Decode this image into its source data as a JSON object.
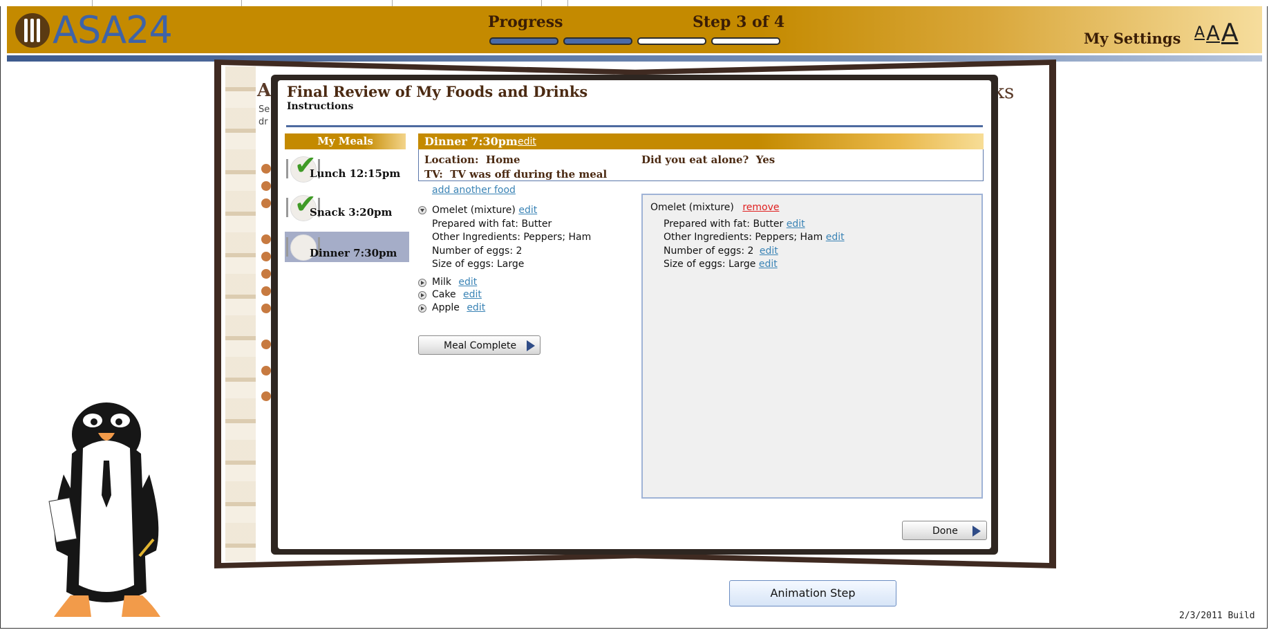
{
  "app": {
    "logo_text": "ASA24",
    "progress_label": "Progress",
    "step_label": "Step 3 of 4",
    "progress": {
      "completed_steps": 2,
      "total_steps": 4
    },
    "settings_label": "My Settings",
    "font_sizes": [
      "A",
      "A",
      "A"
    ]
  },
  "background": {
    "heading_left": "A",
    "sub_line1": "Se",
    "sub_line2": "dr",
    "heading_right": "ks"
  },
  "dialog": {
    "title": "Final Review of My Foods and Drinks",
    "instructions": "Instructions",
    "meals_header": "My Meals",
    "meals": [
      {
        "label": "Lunch 12:15pm",
        "checked": true
      },
      {
        "label": "Snack 3:20pm",
        "checked": true
      },
      {
        "label": "Dinner 7:30pm",
        "checked": false,
        "selected": true
      }
    ],
    "current_meal": {
      "title": "Dinner 7:30pm",
      "edit": "edit",
      "location": "Location:  Home",
      "ate_alone": "Did you eat alone?  Yes",
      "tv": "TV:  TV was off during the meal"
    },
    "add_food": "add another food",
    "foods": [
      {
        "name": "Omelet (mixture)",
        "edit": "edit",
        "expanded": true,
        "details": [
          "Prepared with fat: Butter",
          "Other Ingredients: Peppers; Ham",
          "Number of eggs: 2",
          "Size of eggs: Large"
        ]
      },
      {
        "name": "Milk",
        "edit": "edit"
      },
      {
        "name": "Cake",
        "edit": "edit"
      },
      {
        "name": "Apple",
        "edit": "edit"
      }
    ],
    "meal_complete": "Meal Complete",
    "detail_panel": {
      "food": "Omelet (mixture)",
      "remove": "remove",
      "lines": [
        {
          "text": "Prepared with fat: Butter",
          "edit": "edit"
        },
        {
          "text": "Other Ingredients: Peppers; Ham",
          "edit": "edit"
        },
        {
          "text": "Number of eggs: 2",
          "edit": "edit"
        },
        {
          "text": "Size of eggs: Large",
          "edit": "edit"
        }
      ]
    },
    "done": "Done"
  },
  "animation_step": "Animation Step",
  "build": "2/3/2011 Build",
  "colors": {
    "header_gold": "#c48a00",
    "accent_blue": "#4a6aa8",
    "title_brown": "#4b2a12"
  }
}
